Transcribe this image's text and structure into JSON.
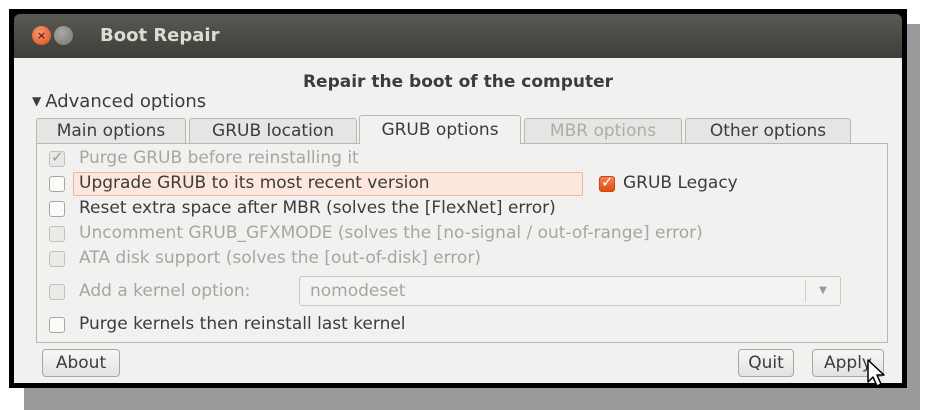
{
  "window": {
    "title": "Boot Repair",
    "close_symbol": "×",
    "minimize_symbol": ""
  },
  "heading": "Repair the boot of the computer",
  "advanced_toggle": {
    "arrow": "▼",
    "label": "Advanced options"
  },
  "tabs": [
    {
      "label": "Main options",
      "state": "normal"
    },
    {
      "label": "GRUB location",
      "state": "normal"
    },
    {
      "label": "GRUB options",
      "state": "active"
    },
    {
      "label": "MBR options",
      "state": "disabled"
    },
    {
      "label": "Other options",
      "state": "normal"
    }
  ],
  "options": {
    "purge_grub": {
      "label": "Purge GRUB before reinstalling it",
      "checked": true,
      "enabled": false
    },
    "upgrade_grub": {
      "label": "Upgrade GRUB to its most recent version",
      "checked": false,
      "enabled": true
    },
    "grub_legacy": {
      "label": "GRUB Legacy",
      "checked": true,
      "enabled": true
    },
    "reset_space": {
      "label": "Reset extra space after MBR (solves the [FlexNet] error)",
      "checked": false,
      "enabled": true
    },
    "uncomment_gfxmode": {
      "label": "Uncomment GRUB_GFXMODE (solves the [no-signal / out-of-range] error)",
      "checked": false,
      "enabled": false
    },
    "ata_support": {
      "label": "ATA disk support (solves the [out-of-disk] error)",
      "checked": false,
      "enabled": false
    },
    "kernel_option": {
      "label": "Add a kernel option:",
      "checked": false,
      "enabled": false,
      "value": "nomodeset",
      "arrow": "▼"
    },
    "purge_kernels": {
      "label": "Purge kernels then reinstall last kernel",
      "checked": false,
      "enabled": true
    }
  },
  "buttons": {
    "about": "About",
    "quit": "Quit",
    "apply": "Apply"
  },
  "colors": {
    "accent_orange": "#de4e15",
    "highlight_bg": "#fde7dd",
    "titlebar": "#3e3e3a"
  }
}
